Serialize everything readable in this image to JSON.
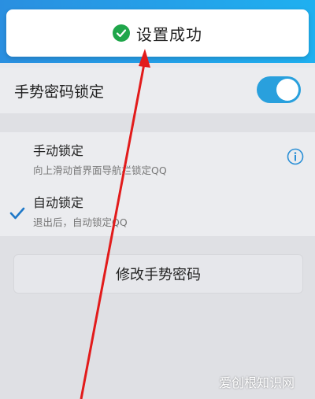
{
  "toast": {
    "text": "设置成功",
    "icon": "check-circle-icon",
    "color": "#1fa64a"
  },
  "gesture_lock": {
    "label": "手势密码锁定",
    "enabled": true,
    "toggle_color": "#29a0dd"
  },
  "lock_options": [
    {
      "title": "手动锁定",
      "subtitle": "向上滑动首界面导航栏锁定QQ",
      "selected": false,
      "icon": "info-icon"
    },
    {
      "title": "自动锁定",
      "subtitle": "退出后，自动锁定QQ",
      "selected": true,
      "icon": "checkmark-icon"
    }
  ],
  "change_password_button": {
    "label": "修改手势密码"
  },
  "watermark": {
    "text": "爱创根知识网"
  },
  "accent_color": "#e21b1b"
}
